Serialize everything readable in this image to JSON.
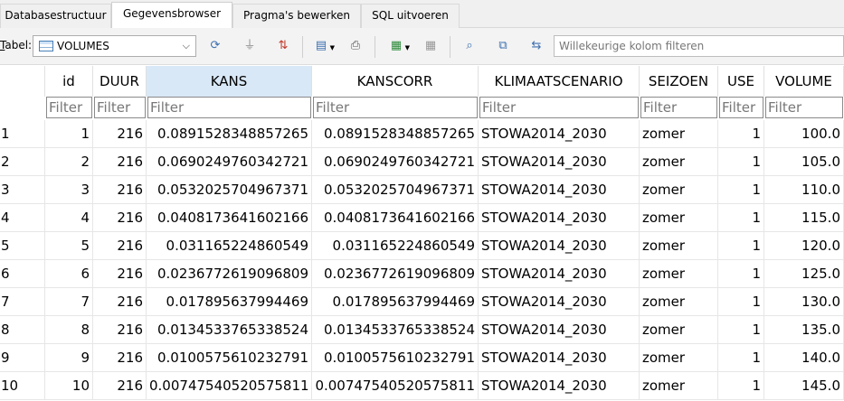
{
  "tabs": [
    "Databasestructuur",
    "Gegevensbrowser",
    "Pragma's bewerken",
    "SQL uitvoeren"
  ],
  "toolbar": {
    "table_label_prefix": "T",
    "table_label_rest": "abel:",
    "table_name": "VOLUMES",
    "column_filter_placeholder": "Willekeurige kolom filteren",
    "icons": [
      "refresh-icon",
      "clear-filters-icon",
      "clear-sort-icon",
      "save-table-icon",
      "print-icon",
      "insert-record-icon",
      "delete-record-icon",
      "find-icon",
      "find-replace-icon",
      "replace-icon"
    ]
  },
  "grid": {
    "columns": [
      "id",
      "DUUR",
      "KANS",
      "KANSCORR",
      "KLIMAATSCENARIO",
      "SEIZOEN",
      "USE",
      "VOLUME"
    ],
    "filter_placeholder": "Filter",
    "rows": [
      {
        "n": "1",
        "cells": [
          "1",
          "216",
          "0.0891528348857265",
          "0.0891528348857265",
          "STOWA2014_2030",
          "zomer",
          "1",
          "100.0"
        ]
      },
      {
        "n": "2",
        "cells": [
          "2",
          "216",
          "0.0690249760342721",
          "0.0690249760342721",
          "STOWA2014_2030",
          "zomer",
          "1",
          "105.0"
        ]
      },
      {
        "n": "3",
        "cells": [
          "3",
          "216",
          "0.0532025704967371",
          "0.0532025704967371",
          "STOWA2014_2030",
          "zomer",
          "1",
          "110.0"
        ]
      },
      {
        "n": "4",
        "cells": [
          "4",
          "216",
          "0.0408173641602166",
          "0.0408173641602166",
          "STOWA2014_2030",
          "zomer",
          "1",
          "115.0"
        ]
      },
      {
        "n": "5",
        "cells": [
          "5",
          "216",
          "0.031165224860549",
          "0.031165224860549",
          "STOWA2014_2030",
          "zomer",
          "1",
          "120.0"
        ]
      },
      {
        "n": "6",
        "cells": [
          "6",
          "216",
          "0.0236772619096809",
          "0.0236772619096809",
          "STOWA2014_2030",
          "zomer",
          "1",
          "125.0"
        ]
      },
      {
        "n": "7",
        "cells": [
          "7",
          "216",
          "0.017895637994469",
          "0.017895637994469",
          "STOWA2014_2030",
          "zomer",
          "1",
          "130.0"
        ]
      },
      {
        "n": "8",
        "cells": [
          "8",
          "216",
          "0.0134533765338524",
          "0.0134533765338524",
          "STOWA2014_2030",
          "zomer",
          "1",
          "135.0"
        ]
      },
      {
        "n": "9",
        "cells": [
          "9",
          "216",
          "0.0100575610232791",
          "0.0100575610232791",
          "STOWA2014_2030",
          "zomer",
          "1",
          "140.0"
        ]
      },
      {
        "n": "10",
        "cells": [
          "10",
          "216",
          "0.00747540520575811",
          "0.00747540520575811",
          "STOWA2014_2030",
          "zomer",
          "1",
          "145.0"
        ]
      }
    ]
  }
}
